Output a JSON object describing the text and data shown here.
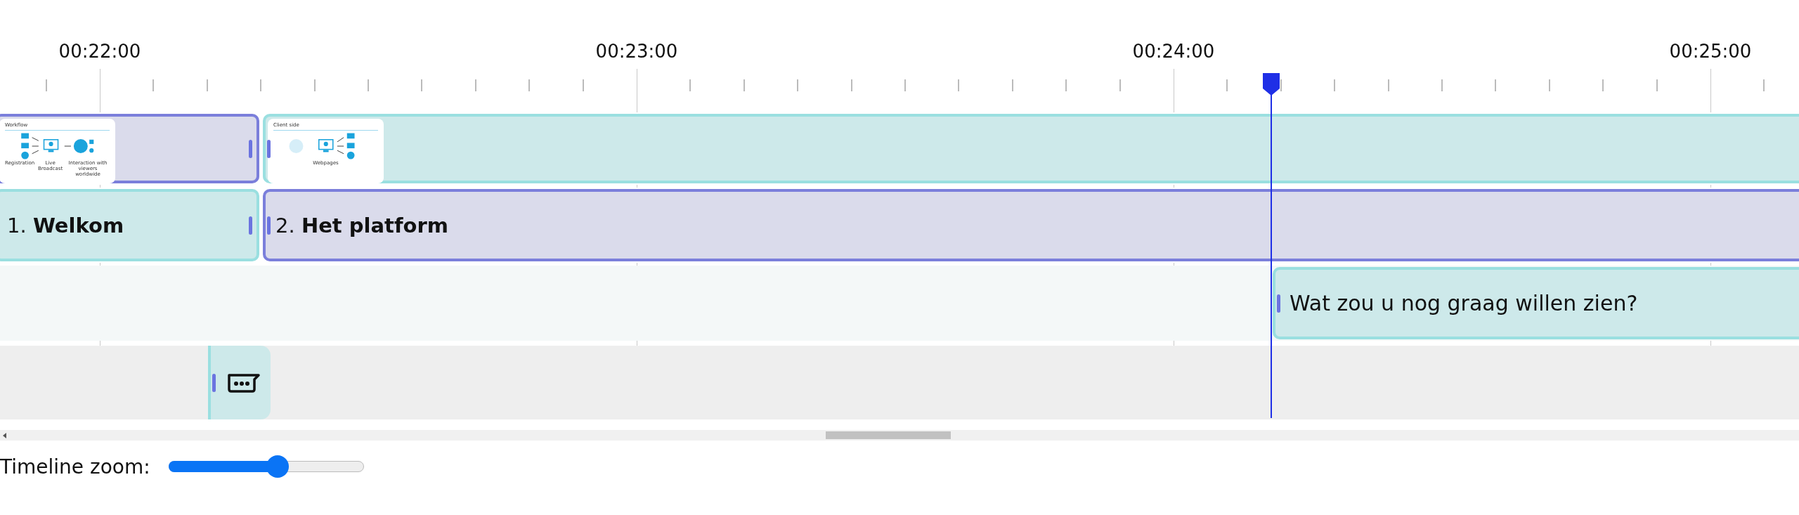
{
  "ruler": {
    "labels": [
      "00:22:00",
      "00:23:00",
      "00:24:00",
      "00:25:00"
    ]
  },
  "tracks": [
    {
      "clips": [
        {
          "kind": "slide",
          "selected": true,
          "thumbnail": {
            "title": "Workflow",
            "labels": [
              "Registration",
              "Live Broadcast",
              "Interaction with viewers worldwide"
            ]
          }
        },
        {
          "kind": "slide",
          "selected": false,
          "thumbnail": {
            "title": "Client side",
            "labels": [
              "Webpages"
            ]
          }
        }
      ]
    },
    {
      "clips": [
        {
          "kind": "chapter",
          "selected": false,
          "label": "1. **Welkom**"
        },
        {
          "kind": "chapter",
          "selected": true,
          "label": "2. **Het platform**"
        }
      ]
    },
    {
      "clips": [
        {
          "kind": "question",
          "selected": false,
          "text": "Wat zou u nog graag willen zien?"
        }
      ]
    },
    {
      "clips": [
        {
          "kind": "chat",
          "selected": false
        }
      ]
    }
  ],
  "zoom": {
    "label": "Timeline zoom:",
    "level": 0.56
  }
}
